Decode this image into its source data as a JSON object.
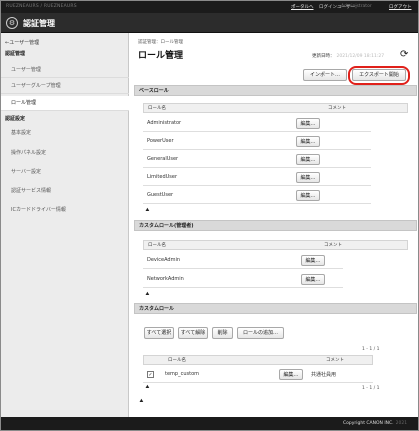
{
  "topbar": {
    "device_name": "RUEZNEAURS / RUEZNEAURS",
    "portal_link": "ポータルへ",
    "login_user_label": "ログインユーザー：",
    "user_name": "Administrator",
    "logout_link": "ログアウト"
  },
  "titlebar": {
    "logo_glyph": "⚙",
    "title": "認証管理"
  },
  "sidebar": {
    "back_link": "←ユーザー管理",
    "section1": "認証管理",
    "items": [
      {
        "label": "ユーザー管理"
      },
      {
        "label": "ユーザーグループ管理"
      },
      {
        "label": "ロール管理"
      }
    ],
    "section2": "認証設定",
    "sub_items": [
      {
        "label": "基本設定"
      },
      {
        "label": "操作パネル設定"
      },
      {
        "label": "サーバー設定"
      },
      {
        "label": "認証サービス情報"
      },
      {
        "label": "ICカードドライバー情報"
      }
    ]
  },
  "main": {
    "breadcrumb": "認証管理：ロール管理",
    "page_title": "ロール管理",
    "updated_label": "更新日時：",
    "updated_value": "2021/12/09 18:11:27",
    "refresh_glyph": "⟳",
    "import_button": "インポート…",
    "export_button": "エクスポート開始",
    "base_roles": {
      "title": "ベースロール",
      "col_name": "ロール名",
      "col_comment": "コメント",
      "edit_label": "編集…",
      "rows": [
        {
          "name": "Administrator"
        },
        {
          "name": "PowerUser"
        },
        {
          "name": "GeneralUser"
        },
        {
          "name": "LimitedUser"
        },
        {
          "name": "GuestUser"
        }
      ]
    },
    "custom_admin_roles": {
      "title": "カスタムロール(管理者)",
      "col_name": "ロール名",
      "col_comment": "コメント",
      "edit_label": "編集…",
      "rows": [
        {
          "name": "DeviceAdmin"
        },
        {
          "name": "NetworkAdmin"
        }
      ]
    },
    "custom_roles": {
      "title": "カスタムロール",
      "select_all": "すべて選択",
      "clear_all": "すべて解除",
      "delete": "削除",
      "add_role": "ロールの追加…",
      "pager_top": "1 - 1 / 1",
      "pager_bottom": "1 - 1 / 1",
      "col_name": "ロール名",
      "col_comment": "コメント",
      "edit_label": "編集…",
      "rows": [
        {
          "name": "temp_custom",
          "comment": "共通社員用",
          "checked": "✓"
        }
      ]
    },
    "collapse_glyph": "⯅"
  },
  "footer": {
    "copyright": "Copyright CANON INC.",
    "year": "2021"
  }
}
